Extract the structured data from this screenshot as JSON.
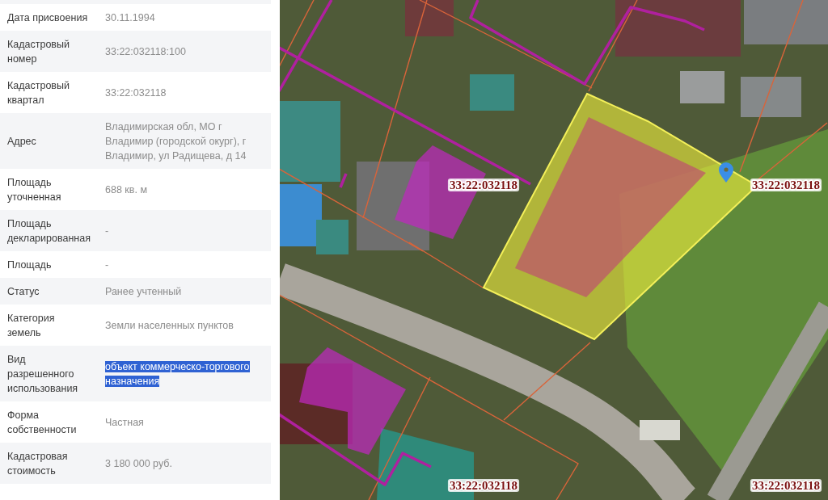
{
  "info_panel": {
    "rows": [
      {
        "label": "Дата присвоения",
        "value": "30.11.1994",
        "highlighted": false
      },
      {
        "label": "Кадастровый номер",
        "value": "33:22:032118:100",
        "highlighted": false
      },
      {
        "label": "Кадастровый квартал",
        "value": "33:22:032118",
        "highlighted": false
      },
      {
        "label": "Адрес",
        "value": "Владимирская обл, МО г Владимир (городской окург), г Владимир, ул Радищева, д 14",
        "highlighted": false
      },
      {
        "label": "Площадь уточненная",
        "value": "688 кв. м",
        "highlighted": false
      },
      {
        "label": "Площадь декларированная",
        "value": "-",
        "highlighted": false
      },
      {
        "label": "Площадь",
        "value": "-",
        "highlighted": false
      },
      {
        "label": "Статус",
        "value": "Ранее учтенный",
        "highlighted": false
      },
      {
        "label": "Категория земель",
        "value": "Земли населенных пунктов",
        "highlighted": false
      },
      {
        "label": "Вид разрешенного использования",
        "value": "объект коммерческо-торгового назначения",
        "highlighted": true
      },
      {
        "label": "Форма собственности",
        "value": "Частная",
        "highlighted": false
      },
      {
        "label": "Кадастровая стоимость",
        "value": "3 180 000 руб.",
        "highlighted": false
      }
    ]
  },
  "map": {
    "labels": [
      "33:22:032118",
      "33:22:032118",
      "33:22:032118",
      "33:22:032118"
    ]
  }
}
